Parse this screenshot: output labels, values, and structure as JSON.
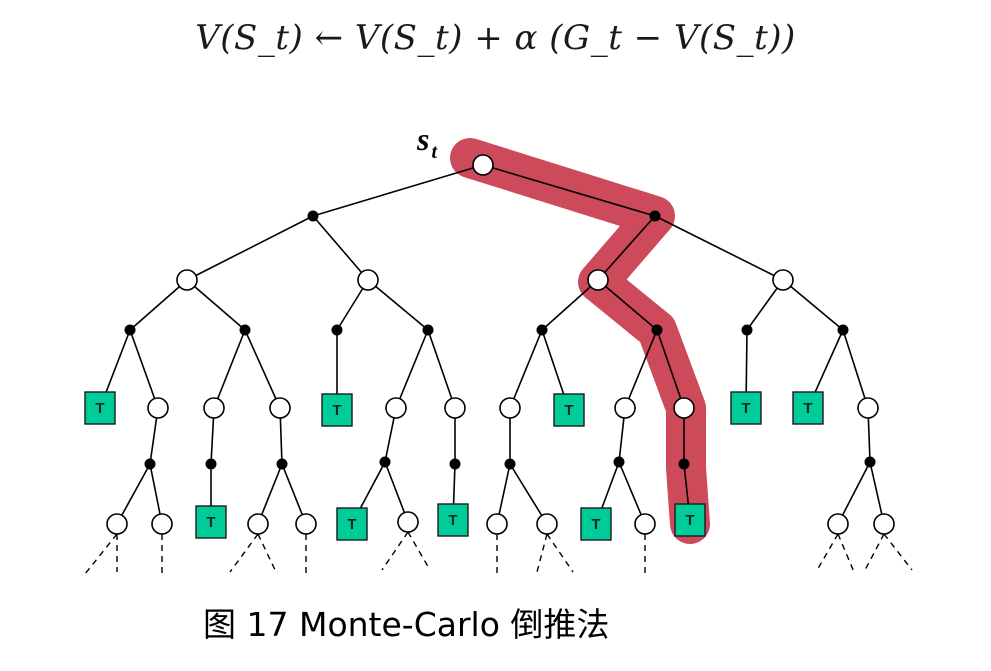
{
  "formula": "V(S_t) ← V(S_t) + α (G_t − V(S_t))",
  "root_label": "s",
  "root_subscript": "t",
  "terminal_label": "T",
  "caption": "图 17 Monte-Carlo 倒推法",
  "colors": {
    "highlight": "#cc4a5a",
    "terminal_fill": "#00cc99",
    "edge": "#000000",
    "chance_node": "#000000",
    "state_node_fill": "#ffffff"
  }
}
